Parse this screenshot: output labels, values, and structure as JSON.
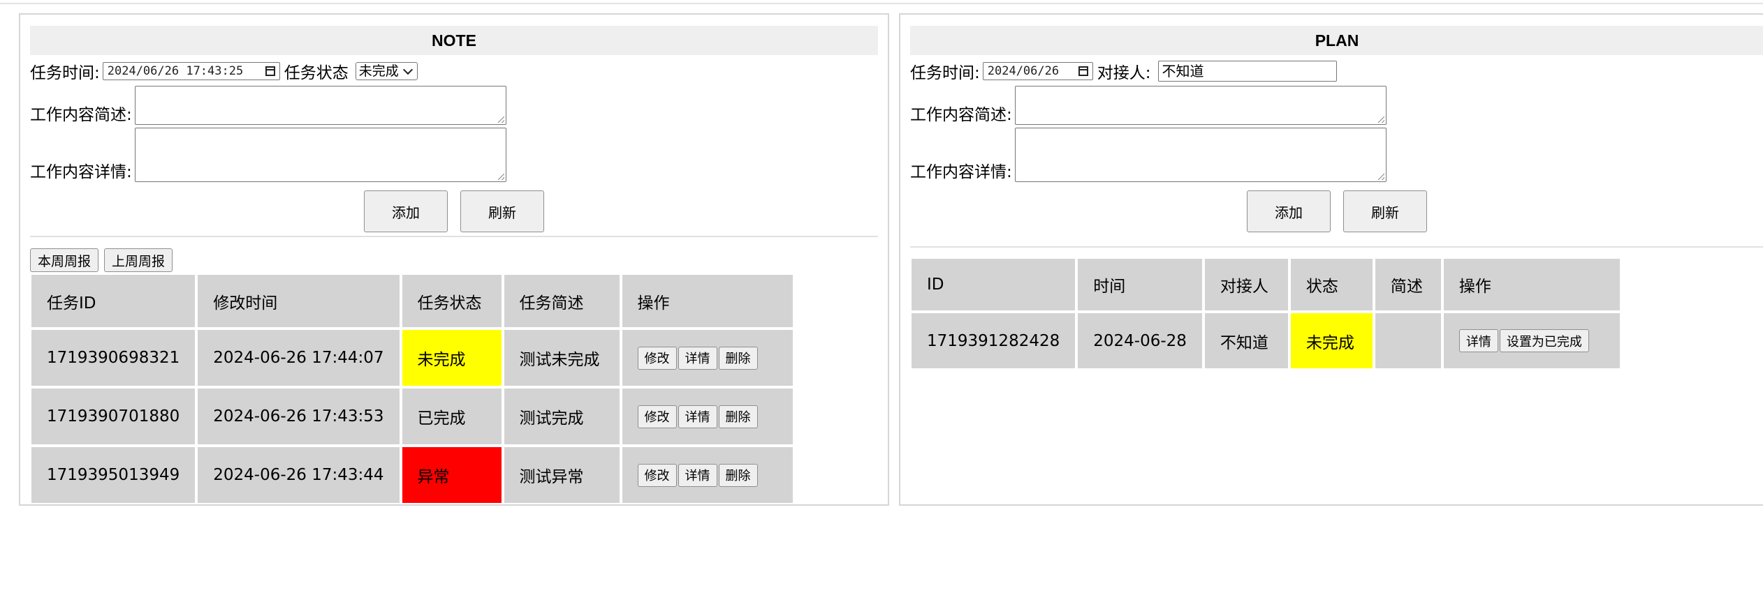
{
  "note": {
    "title": "NOTE",
    "task_time_label": "任务时间:",
    "task_time_value": "2024/06/26 17:43:25",
    "task_status_label": "任务状态",
    "task_status_selected": "未完成",
    "brief_label": "工作内容简述:",
    "detail_label": "工作内容详情:",
    "add_label": "添加",
    "refresh_label": "刷新",
    "this_week_label": "本周周报",
    "last_week_label": "上周周报",
    "table": {
      "headers": [
        "任务ID",
        "修改时间",
        "任务状态",
        "任务简述",
        "操作"
      ],
      "rows": [
        {
          "id": "1719390698321",
          "time": "2024-06-26 17:44:07",
          "status": "未完成",
          "status_color": "#ffff00",
          "brief": "测试未完成"
        },
        {
          "id": "1719390701880",
          "time": "2024-06-26 17:43:53",
          "status": "已完成",
          "status_color": "#d3d3d3",
          "brief": "测试完成"
        },
        {
          "id": "1719395013949",
          "time": "2024-06-26 17:43:44",
          "status": "异常",
          "status_color": "#ff0000",
          "brief": "测试异常"
        }
      ],
      "edit_label": "修改",
      "detail_label": "详情",
      "delete_label": "删除"
    }
  },
  "plan": {
    "title": "PLAN",
    "task_time_label": "任务时间:",
    "task_time_value": "2024/06/26",
    "contact_label": "对接人:",
    "contact_value": "不知道",
    "brief_label": "工作内容简述:",
    "detail_label": "工作内容详情:",
    "add_label": "添加",
    "refresh_label": "刷新",
    "table": {
      "headers": [
        "ID",
        "时间",
        "对接人",
        "状态",
        "简述",
        "操作"
      ],
      "rows": [
        {
          "id": "1719391282428",
          "time": "2024-06-28",
          "contact": "不知道",
          "status": "未完成",
          "status_color": "#ffff00",
          "brief": ""
        }
      ],
      "detail_label": "详情",
      "set_done_label": "设置为已完成"
    }
  }
}
